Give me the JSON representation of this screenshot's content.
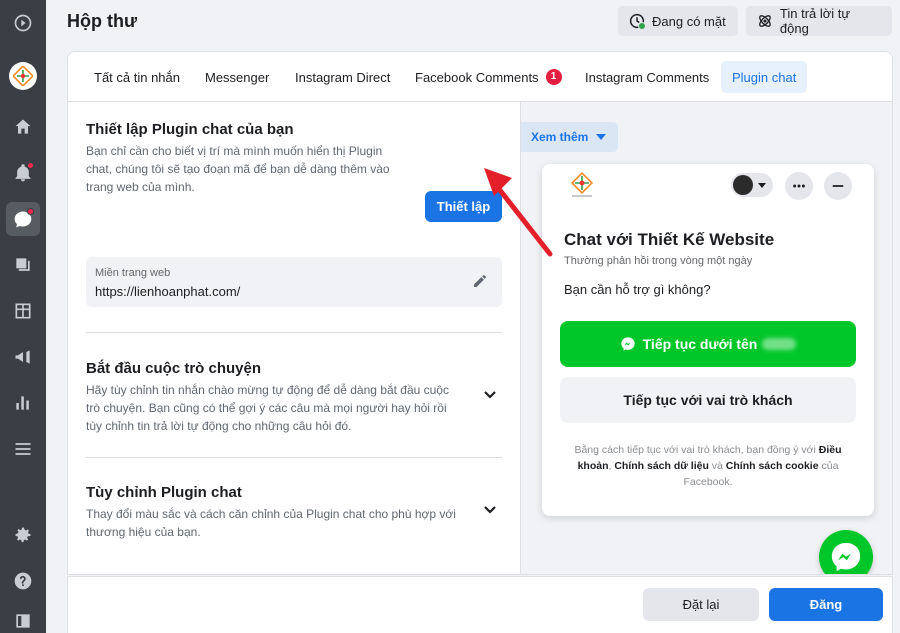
{
  "header": {
    "title": "Hộp thư",
    "status_label": "Đang có mặt",
    "auto_reply_label": "Tin trả lời tự động"
  },
  "tabs": [
    {
      "label": "Tất cả tin nhắn"
    },
    {
      "label": "Messenger"
    },
    {
      "label": "Instagram Direct"
    },
    {
      "label": "Facebook Comments",
      "badge": "1"
    },
    {
      "label": "Instagram Comments"
    },
    {
      "label": "Plugin chat"
    }
  ],
  "setup": {
    "title": "Thiết lập Plugin chat của bạn",
    "desc_line1": "Bạn chỉ cần cho biết vị trí mà mình muốn hiển thị Plugin",
    "desc_line2": "chat, chúng tôi sẽ tạo đoạn mã để bạn dễ dàng thêm vào",
    "desc_line3": "trang web của mình.",
    "button_label": "Thiết lập",
    "domain_label": "Miền trang web",
    "domain_value": "https://lienhoanphat.com/"
  },
  "start_chat": {
    "title": "Bắt đầu cuộc trò chuyện",
    "desc_line1": "Hãy tùy chỉnh tin nhắn chào mừng tự động để dễ dàng bắt đầu cuộc",
    "desc_line2": "trò chuyện. Bạn cũng có thể gợi ý các câu mà mọi người hay hỏi rồi",
    "desc_line3": "tùy chỉnh tin trả lời tự động cho những câu hỏi đó."
  },
  "customize": {
    "title": "Tùy chỉnh Plugin chat",
    "desc_line1": "Thay đổi màu sắc và cách căn chỉnh của Plugin chat cho phù hợp với",
    "desc_line2": "thương hiệu của bạn."
  },
  "preview": {
    "see_more_label": "Xem thêm",
    "chat_title": "Chat với Thiết Kế Website",
    "chat_subtitle": "Thường phản hồi trong vòng một ngày",
    "chat_question": "Bạn cần hỗ trợ gì không?",
    "continue_as_label": "Tiếp tục dưới tên",
    "guest_label": "Tiếp tục với vai trò khách",
    "legal_prefix": "Bằng cách tiếp tục với vai trò khách, bạn đồng ý với",
    "legal_terms": "Điều khoản",
    "legal_sep1": ", ",
    "legal_data_policy": "Chính sách dữ liệu",
    "legal_and": " và ",
    "legal_cookie_policy": "Chính sách cookie",
    "legal_suffix": " của Facebook."
  },
  "footer": {
    "reset_label": "Đặt lại",
    "publish_label": "Đăng"
  },
  "colors": {
    "primary": "#1b74e4",
    "green": "#00c729",
    "sidebar": "#3b3e44",
    "badge": "#e41e3f",
    "arrow": "#e3202a"
  }
}
